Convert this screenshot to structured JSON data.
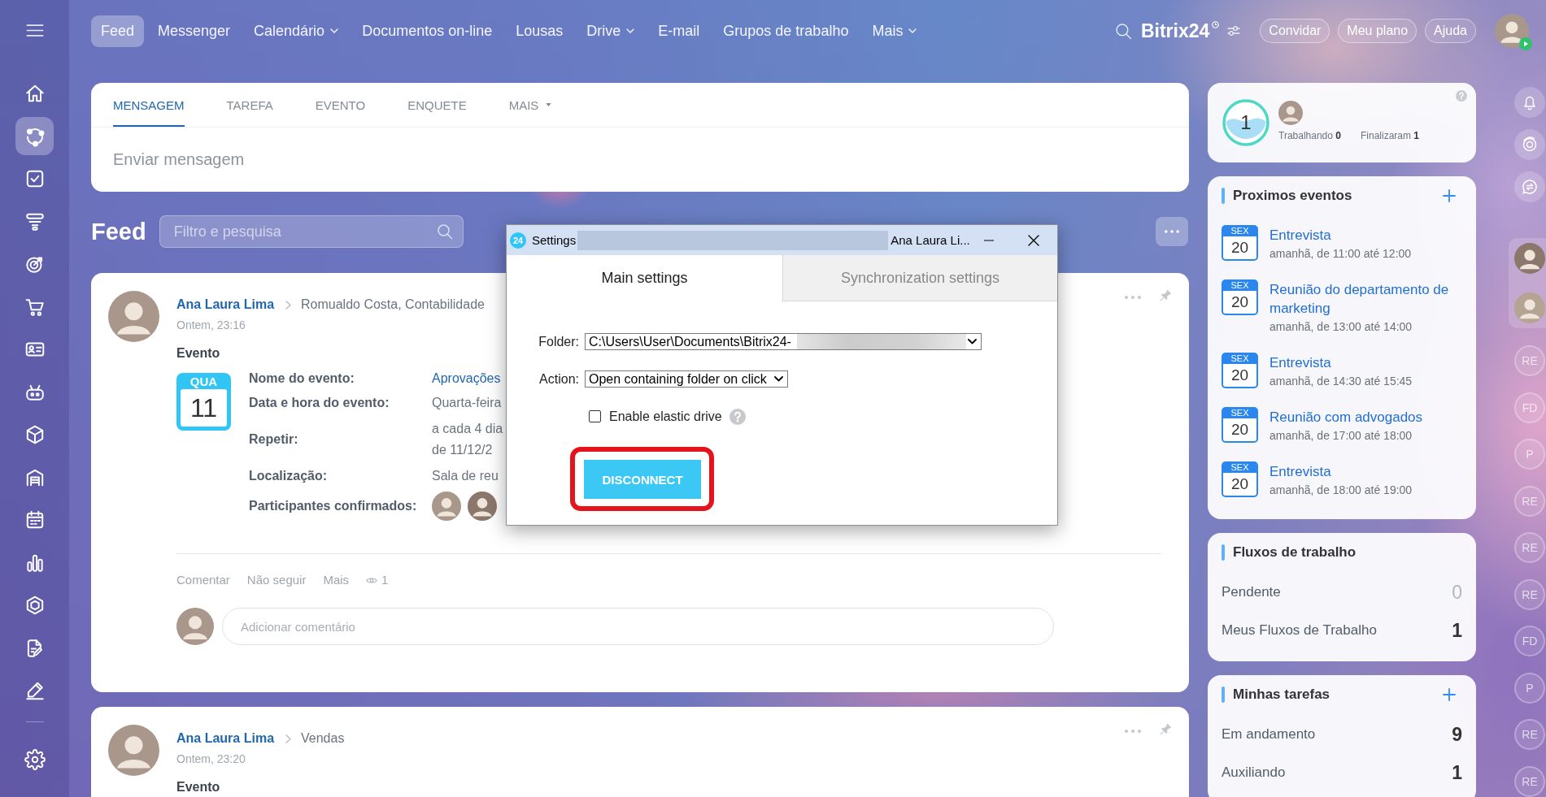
{
  "sidebar": {
    "items": [
      {
        "selected": false
      },
      {
        "selected": true
      },
      {
        "selected": false
      },
      {
        "selected": false
      },
      {
        "selected": false
      },
      {
        "selected": false
      },
      {
        "selected": false
      },
      {
        "selected": false
      },
      {
        "selected": false
      },
      {
        "selected": false
      },
      {
        "selected": false
      },
      {
        "selected": false
      },
      {
        "selected": false
      },
      {
        "selected": false
      },
      {
        "selected": false
      }
    ]
  },
  "topbar": {
    "nav": [
      {
        "label": "Feed",
        "selected": true,
        "dropdown": false
      },
      {
        "label": "Messenger",
        "selected": false,
        "dropdown": false
      },
      {
        "label": "Calendário",
        "selected": false,
        "dropdown": true
      },
      {
        "label": "Documentos on-line",
        "selected": false,
        "dropdown": false
      },
      {
        "label": "Lousas",
        "selected": false,
        "dropdown": false
      },
      {
        "label": "Drive",
        "selected": false,
        "dropdown": true
      },
      {
        "label": "E-mail",
        "selected": false,
        "dropdown": false
      },
      {
        "label": "Grupos de trabalho",
        "selected": false,
        "dropdown": false
      },
      {
        "label": "Mais",
        "selected": false,
        "dropdown": true
      }
    ],
    "logo": "Bitrix24",
    "buttons": [
      "Convidar",
      "Meu plano",
      "Ajuda"
    ]
  },
  "composer": {
    "tabs": [
      {
        "label": "MENSAGEM",
        "selected": true,
        "dropdown": false
      },
      {
        "label": "TAREFA",
        "selected": false,
        "dropdown": false
      },
      {
        "label": "EVENTO",
        "selected": false,
        "dropdown": false
      },
      {
        "label": "ENQUETE",
        "selected": false,
        "dropdown": false
      },
      {
        "label": "MAIS",
        "selected": false,
        "dropdown": true
      }
    ],
    "placeholder": "Enviar mensagem"
  },
  "feed": {
    "title": "Feed",
    "search": {
      "placeholder": "Filtro e pesquisa"
    },
    "posts": [
      {
        "author": "Ana Laura Lima",
        "recipients": "Romualdo Costa, Contabilidade",
        "time": "Ontem, 23:16",
        "type": "Evento",
        "event": {
          "weekday": "QUA",
          "day": "11",
          "fields": [
            {
              "kind": "link",
              "label": "Nome do evento:",
              "lines": [
                "Aprovações"
              ]
            },
            {
              "kind": "text",
              "label": "Data e hora do evento:",
              "lines": [
                "Quarta-feira"
              ]
            },
            {
              "kind": "text",
              "label": "Repetir:",
              "lines": [
                "a cada 4 dia",
                "de 11/12/2"
              ]
            },
            {
              "kind": "text",
              "label": "Localização:",
              "lines": [
                "Sala de reu"
              ]
            },
            {
              "kind": "participants",
              "label": "Participantes confirmados:"
            }
          ]
        },
        "actions": [
          "Comentar",
          "Não seguir",
          "Mais"
        ],
        "views": "1",
        "comment_placeholder": "Adicionar comentário"
      },
      {
        "author": "Ana Laura Lima",
        "recipients": "Vendas",
        "time": "Ontem, 23:20",
        "type": "Evento"
      }
    ]
  },
  "right_panel": {
    "tracker": {
      "count": "1",
      "stats": [
        "Trabalhando **0**",
        "Finalizaram **1**"
      ]
    },
    "events": {
      "title": "Proximos eventos",
      "add_button": true,
      "items": [
        {
          "weekday": "SEX",
          "day": "20",
          "title": "Entrevista",
          "time": "amanhã, de 11:00 até 12:00"
        },
        {
          "weekday": "SEX",
          "day": "20",
          "title": "Reunião do departamento de marketing",
          "time": "amanhã, de 13:00 até 14:00"
        },
        {
          "weekday": "SEX",
          "day": "20",
          "title": "Entrevista",
          "time": "amanhã, de 14:30 até 15:45"
        },
        {
          "weekday": "SEX",
          "day": "20",
          "title": "Reunião com advogados",
          "time": "amanhã, de 17:00 até 18:00"
        },
        {
          "weekday": "SEX",
          "day": "20",
          "title": "Entrevista",
          "time": "amanhã, de 18:00 até 19:00"
        }
      ]
    },
    "workflows": {
      "title": "Fluxos de trabalho",
      "rows": [
        {
          "label": "Pendente",
          "count": "0",
          "muted": true
        },
        {
          "label": "Meus Fluxos de Trabalho",
          "count": "1",
          "muted": false
        }
      ]
    },
    "tasks": {
      "title": "Minhas tarefas",
      "add_button": true,
      "rows": [
        {
          "label": "Em andamento",
          "count": "9",
          "muted": false
        },
        {
          "label": "Auxiliando",
          "count": "1",
          "muted": false
        }
      ]
    }
  },
  "rail": {
    "contacts": [
      "RE",
      "FD",
      "P",
      "RE",
      "RE",
      "RE",
      "FD",
      "P",
      "RE",
      "RE"
    ]
  },
  "dialog": {
    "app_icon": "24",
    "title": "Settings",
    "account": "Ana Laura Li...",
    "tabs": [
      {
        "label": "Main settings",
        "selected": true
      },
      {
        "label": "Synchronization settings",
        "selected": false
      }
    ],
    "folder": {
      "label": "Folder:",
      "value": "C:\\Users\\User\\Documents\\Bitrix24-"
    },
    "action": {
      "label": "Action:",
      "value": "Open containing folder on click"
    },
    "elastic_drive": {
      "label": "Enable elastic drive",
      "checked": false
    },
    "button": "DISCONNECT"
  }
}
